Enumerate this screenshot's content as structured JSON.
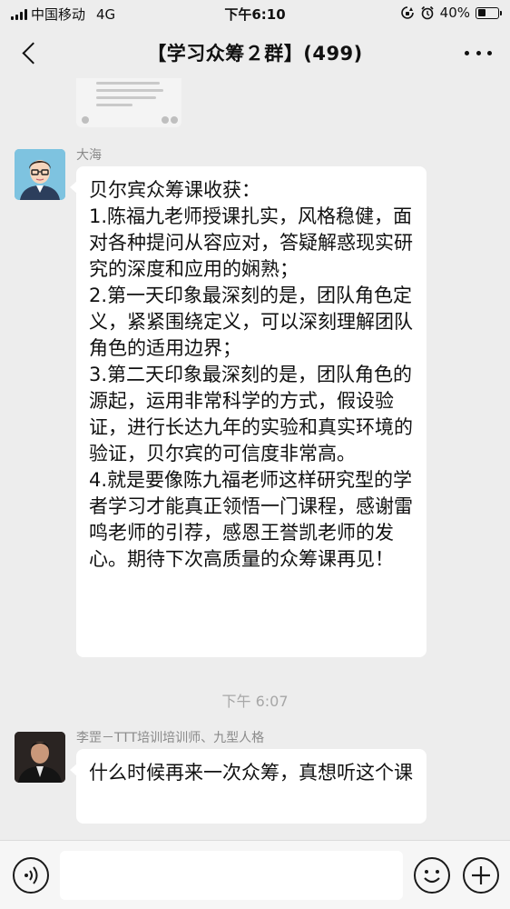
{
  "status_bar": {
    "carrier": "中国移动",
    "network": "4G",
    "time": "下午6:10",
    "battery_percent": "40%",
    "battery_level": 0.4
  },
  "header": {
    "title": "【学习众筹２群】(499)"
  },
  "messages": [
    {
      "sender": "大海",
      "text": "贝尔宾众筹课收获：\n1.陈福九老师授课扎实，风格稳健，面对各种提问从容应对，答疑解惑现实研究的深度和应用的娴熟；\n2.第一天印象最深刻的是，团队角色定义，紧紧围绕定义，可以深刻理解团队角色的适用边界；\n3.第二天印象最深刻的是，团队角色的源起，运用非常科学的方式，假设验证，进行长达九年的实验和真实环境的验证，贝尔宾的可信度非常高。\n4.就是要像陈九福老师这样研究型的学者学习才能真正领悟一门课程，感谢雷鸣老师的引荐，感恩王誉凯老师的发心。期待下次高质量的众筹课再见！"
    },
    {
      "sender": "李罡－TTT培训培训师、九型人格",
      "text": "什么时候再来一次众筹，真想听这个课"
    }
  ],
  "time_divider": "下午 6:07",
  "input": {
    "placeholder": ""
  },
  "icons": {
    "voice": "voice-icon",
    "emoji": "emoji-icon",
    "add": "plus-icon",
    "back": "back-chevron-icon",
    "more": "more-dots-icon"
  }
}
